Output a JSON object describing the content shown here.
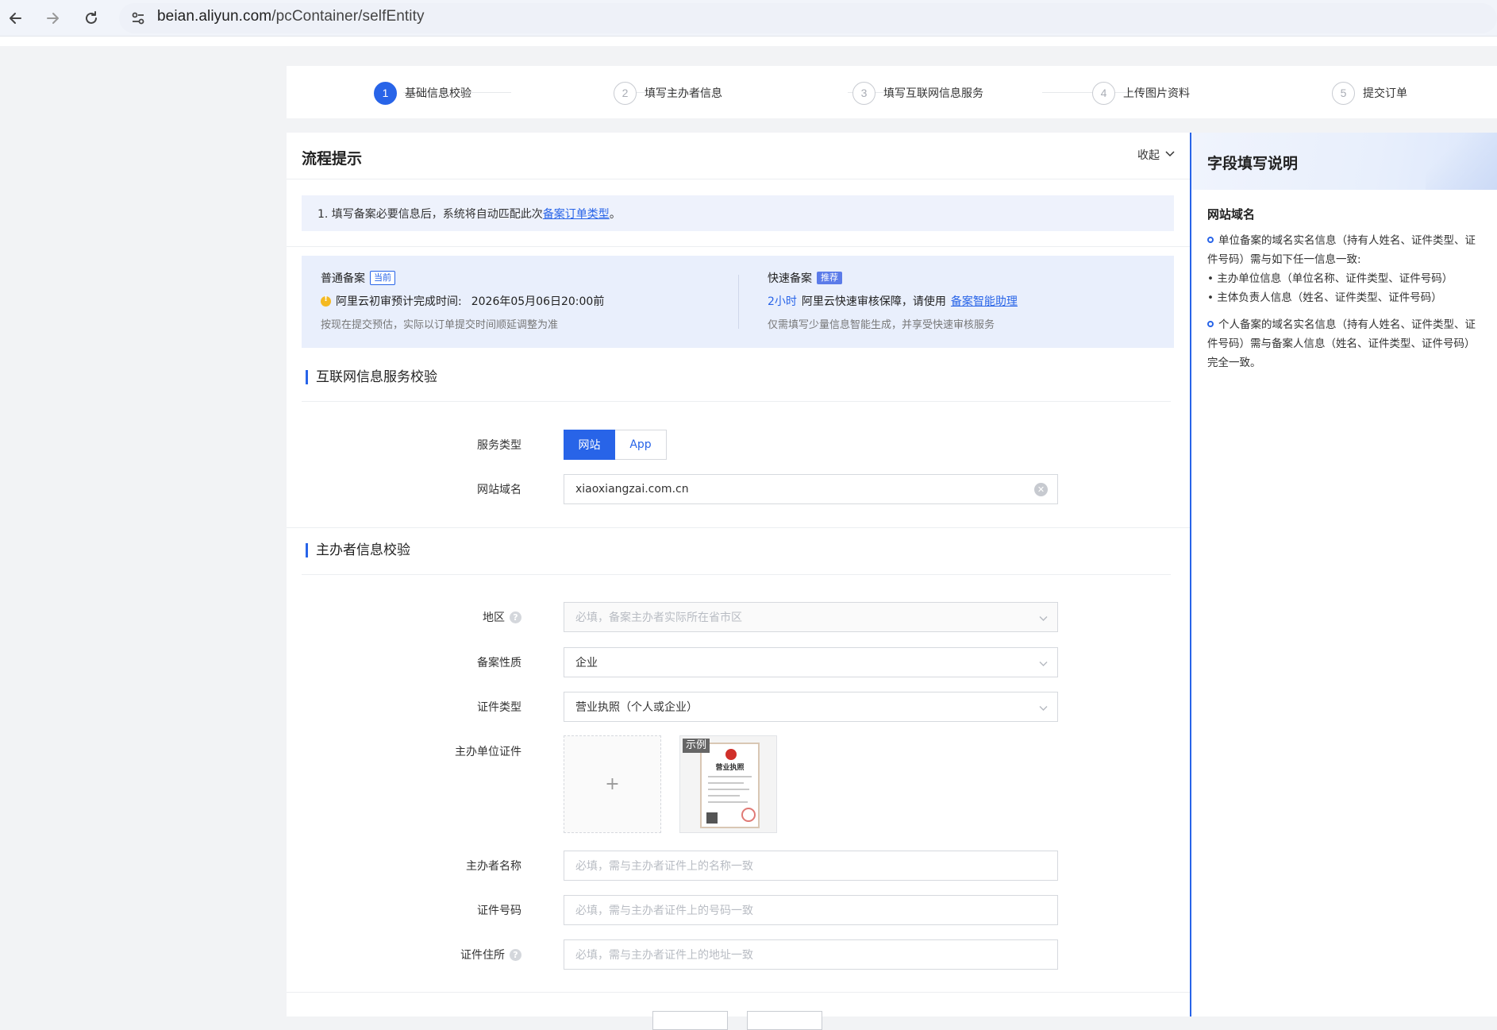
{
  "browser": {
    "url_domain": "beian.aliyun.com",
    "url_path": "/pcContainer/selfEntity"
  },
  "steps": [
    {
      "num": "1",
      "label": "基础信息校验",
      "active": true
    },
    {
      "num": "2",
      "label": "填写主办者信息",
      "active": false
    },
    {
      "num": "3",
      "label": "填写互联网信息服务",
      "active": false
    },
    {
      "num": "4",
      "label": "上传图片资料",
      "active": false
    },
    {
      "num": "5",
      "label": "提交订单",
      "active": false
    }
  ],
  "flow": {
    "title": "流程提示",
    "collapse_label": "收起",
    "tip_prefix": "1. 填写备案必要信息后，系统将自动匹配此次",
    "tip_link": "备案订单类型",
    "tip_suffix": "。"
  },
  "filing": {
    "normal": {
      "title": "普通备案",
      "badge": "当前",
      "eta_label": "阿里云初审预计完成时间:",
      "eta_value": "2026年05月06日20:00前",
      "note": "按现在提交预估，实际以订单提交时间顺延调整为准"
    },
    "fast": {
      "title": "快速备案",
      "badge": "推荐",
      "hours": "2小时",
      "guarantee": "阿里云快速审核保障，请使用",
      "link": "备案智能助理",
      "note": "仅需填写少量信息智能生成，并享受快速审核服务"
    }
  },
  "internet_section": {
    "title": "互联网信息服务校验",
    "service_type_label": "服务类型",
    "service_options": [
      "网站",
      "App"
    ],
    "selected_service": "网站",
    "domain_label": "网站域名",
    "domain_value": "xiaoxiangzai.com.cn"
  },
  "host_section": {
    "title": "主办者信息校验",
    "region_label": "地区",
    "region_placeholder": "必填，备案主办者实际所在省市区",
    "nature_label": "备案性质",
    "nature_value": "企业",
    "cert_type_label": "证件类型",
    "cert_type_value": "营业执照（个人或企业）",
    "cert_label": "主办单位证件",
    "sample_tag": "示例",
    "sample_title": "营业执照",
    "host_name_label": "主办者名称",
    "host_name_placeholder": "必填，需与主办者证件上的名称一致",
    "cert_no_label": "证件号码",
    "cert_no_placeholder": "必填，需与主办者证件上的号码一致",
    "cert_addr_label": "证件住所",
    "cert_addr_placeholder": "必填，需与主办者证件上的地址一致"
  },
  "side": {
    "title": "字段填写说明",
    "subtitle": "网站域名",
    "p1": "单位备案的域名实名信息（持有人姓名、证件类型、证件号码）需与如下任一信息一致:",
    "b1": "• 主办单位信息（单位名称、证件类型、证件号码）",
    "b2": "• 主体负责人信息（姓名、证件类型、证件号码）",
    "p2": "个人备案的域名实名信息（持有人姓名、证件类型、证件号码）需与备案人信息（姓名、证件类型、证件号码）完全一致。"
  },
  "colors": {
    "accent": "#2864e8",
    "warning": "#f4b921"
  }
}
